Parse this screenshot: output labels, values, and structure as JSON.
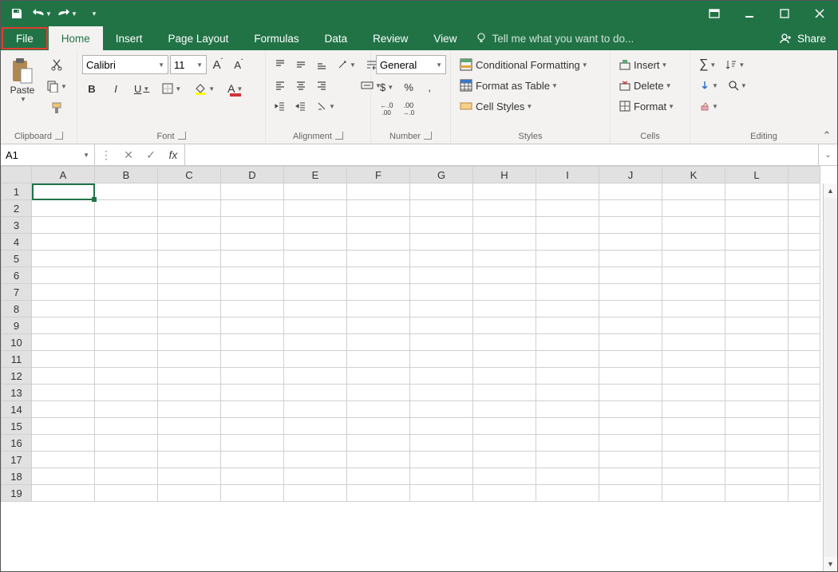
{
  "qat": {
    "save": "save-icon",
    "undo": "undo-icon",
    "redo": "redo-icon",
    "custom": "customize-icon"
  },
  "tabs": {
    "file": "File",
    "home": "Home",
    "insert": "Insert",
    "page_layout": "Page Layout",
    "formulas": "Formulas",
    "data": "Data",
    "review": "Review",
    "view": "View",
    "tellme": "Tell me what you want to do...",
    "share": "Share"
  },
  "ribbon": {
    "clipboard": {
      "label": "Clipboard",
      "paste": "Paste"
    },
    "font": {
      "label": "Font",
      "name": "Calibri",
      "size": "11",
      "bold": "B",
      "italic": "I",
      "underline": "U"
    },
    "alignment": {
      "label": "Alignment"
    },
    "number": {
      "label": "Number",
      "format": "General",
      "currency": "$",
      "percent": "%",
      "comma": ",",
      "inc": "←.0",
      "dec": ".00→",
      "inc_label": ".00",
      "dec_label": ".0"
    },
    "styles": {
      "label": "Styles",
      "cf": "Conditional Formatting",
      "table": "Format as Table",
      "cell": "Cell Styles"
    },
    "cells": {
      "label": "Cells",
      "insert": "Insert",
      "delete": "Delete",
      "format": "Format"
    },
    "editing": {
      "label": "Editing"
    }
  },
  "namebox": {
    "value": "A1",
    "fx": "fx"
  },
  "columns": [
    "A",
    "B",
    "C",
    "D",
    "E",
    "F",
    "G",
    "H",
    "I",
    "J",
    "K",
    "L"
  ],
  "rows": [
    "1",
    "2",
    "3",
    "4",
    "5",
    "6",
    "7",
    "8",
    "9",
    "10",
    "11",
    "12",
    "13",
    "14",
    "15",
    "16",
    "17",
    "18",
    "19"
  ],
  "selected_cell": "A1"
}
